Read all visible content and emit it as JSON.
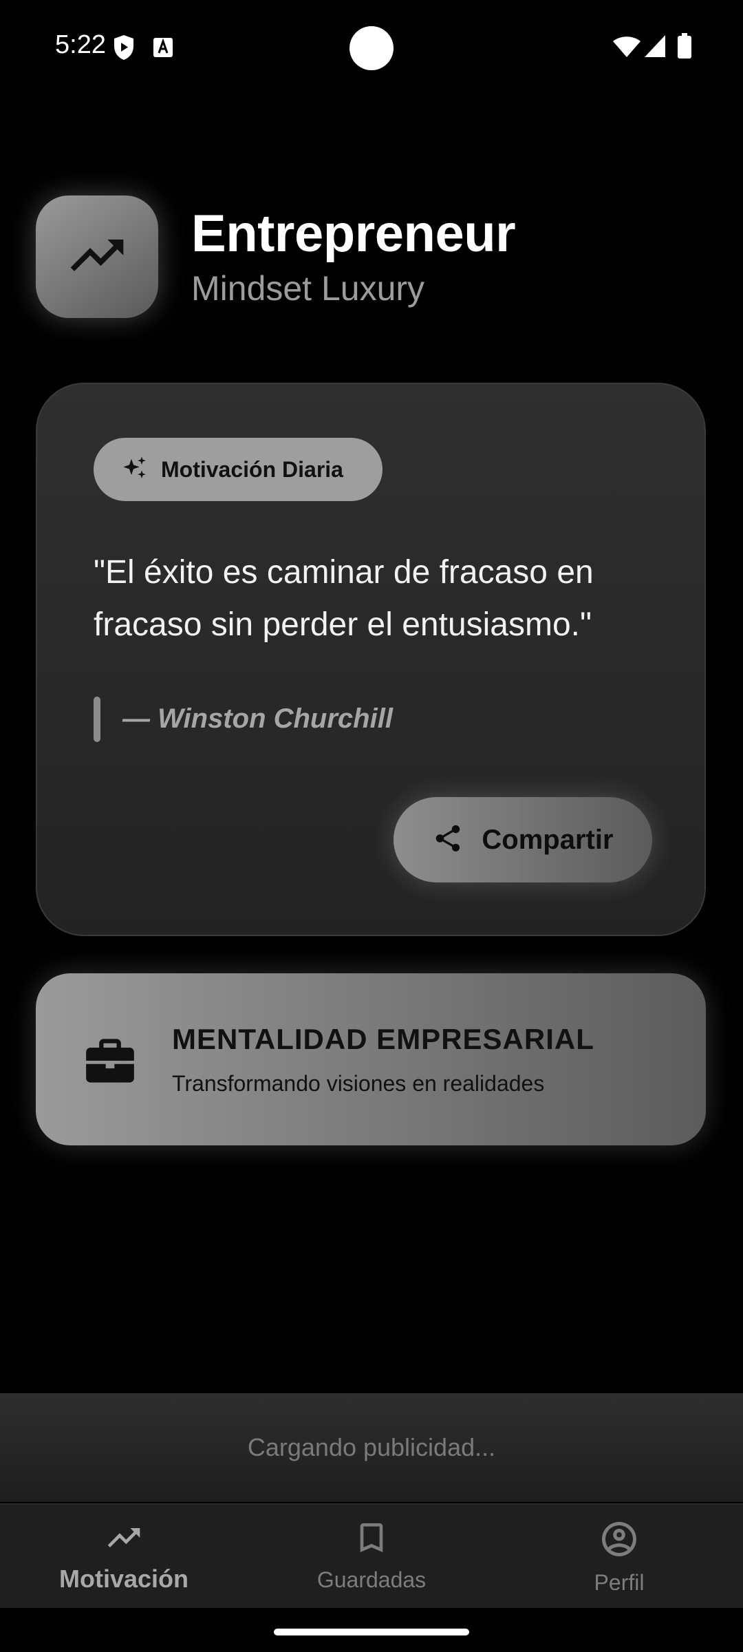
{
  "status_bar": {
    "time": "5:22",
    "icons": [
      "shield-play-icon",
      "font-a-icon",
      "wifi-icon",
      "signal-icon",
      "battery-icon"
    ]
  },
  "header": {
    "logo_icon": "trending-up-icon",
    "title": "Entrepreneur",
    "subtitle": "Mindset Luxury"
  },
  "quote_card": {
    "chip_icon": "sparkles-icon",
    "chip_label": "Motivación Diaria",
    "quote": "\"El éxito es caminar de fracaso en fracaso sin perder el entusiasmo.\"",
    "author": "— Winston Churchill",
    "share_icon": "share-icon",
    "share_label": "Compartir"
  },
  "banner": {
    "icon": "briefcase-icon",
    "title": "MENTALIDAD EMPRESARIAL",
    "subtitle": "Transformando visiones en realidades"
  },
  "ad": {
    "loading_text": "Cargando publicidad..."
  },
  "bottom_nav": {
    "items": [
      {
        "label": "Motivación",
        "icon": "trending-up-icon",
        "active": true
      },
      {
        "label": "Guardadas",
        "icon": "bookmark-icon",
        "active": false
      },
      {
        "label": "Perfil",
        "icon": "account-circle-icon",
        "active": false
      }
    ]
  },
  "colors": {
    "background": "#000000",
    "card": "#2a2a2a",
    "accent_gray": "#9e9e9e",
    "text_primary": "#ffffff",
    "text_secondary": "#9c9c9c"
  }
}
